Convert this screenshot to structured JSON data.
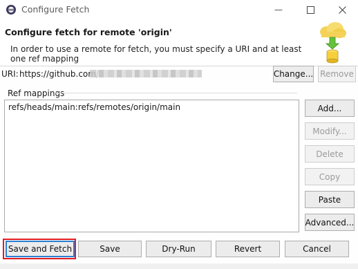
{
  "window": {
    "title": "Configure Fetch"
  },
  "banner": {
    "title": "Configure fetch for remote 'origin'",
    "message": "In order to use a remote for fetch, you must specify a URI and at least one ref mapping"
  },
  "uri": {
    "label": "URI:",
    "value": "https://github.com/",
    "change_label": "Change...",
    "remove_label": "Remove"
  },
  "ref_mappings": {
    "label": "Ref mappings",
    "items": [
      "refs/heads/main:refs/remotes/origin/main"
    ],
    "buttons": {
      "add": "Add...",
      "modify": "Modify...",
      "delete": "Delete",
      "copy": "Copy",
      "paste": "Paste",
      "advanced": "Advanced..."
    }
  },
  "footer": {
    "save_fetch": "Save and Fetch",
    "save": "Save",
    "dry_run": "Dry-Run",
    "revert": "Revert",
    "cancel": "Cancel"
  },
  "icons": {
    "app": "eclipse-icon",
    "fetch": "cloud-fetch-icon"
  },
  "colors": {
    "focus_highlight": "#e01b24",
    "focus_border": "#2a7fd4"
  }
}
